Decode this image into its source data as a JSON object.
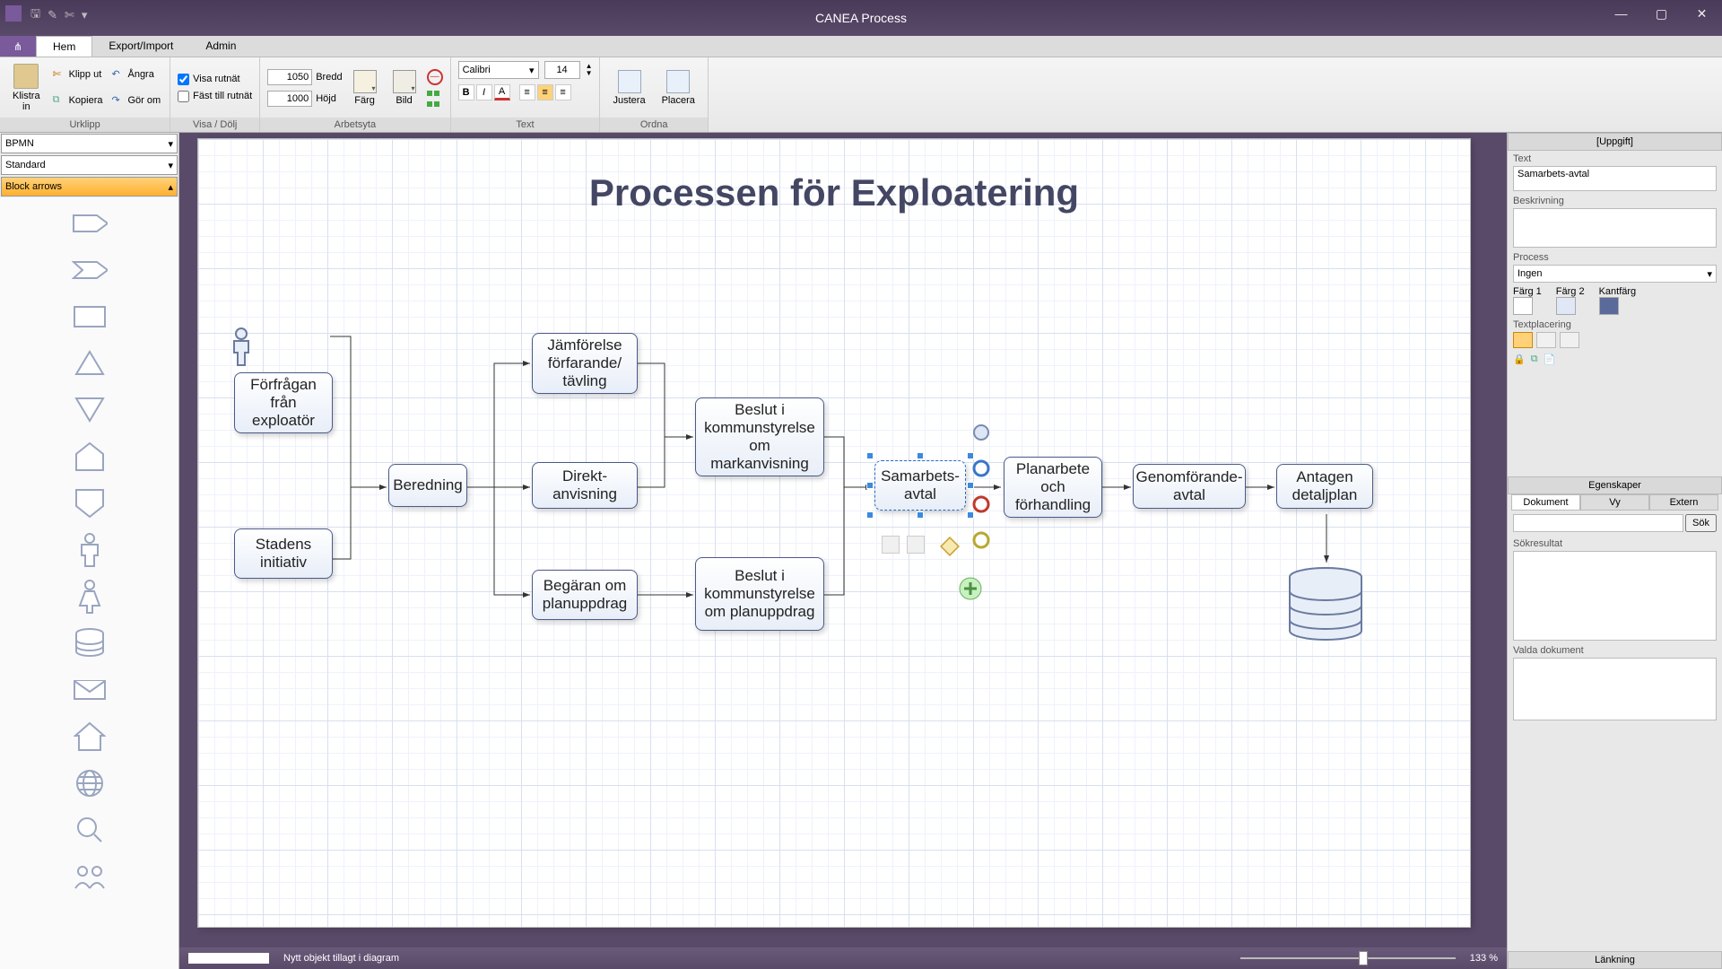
{
  "app": {
    "title": "CANEA Process"
  },
  "tabs": {
    "home": "Hem",
    "export": "Export/Import",
    "admin": "Admin"
  },
  "ribbon": {
    "clipboard": {
      "paste": "Klistra\nin",
      "cut": "Klipp ut",
      "copy": "Kopiera",
      "undo": "Ångra",
      "rename": "Gör om",
      "group": "Urklipp"
    },
    "showhide": {
      "grid": "Visa rutnät",
      "snap": "Fäst till rutnät",
      "group": "Visa / Dölj"
    },
    "workspace": {
      "width_val": "1050",
      "width_lbl": "Bredd",
      "height_val": "1000",
      "height_lbl": "Höjd",
      "color": "Färg",
      "image": "Bild",
      "group": "Arbetsyta"
    },
    "text": {
      "font": "Calibri",
      "size": "14",
      "group": "Text"
    },
    "arrange": {
      "align": "Justera",
      "place": "Placera",
      "group": "Ordna"
    }
  },
  "shape_panel": {
    "cat1": "BPMN",
    "cat2": "Standard",
    "cat3": "Block arrows"
  },
  "diagram": {
    "title": "Processen för Exploatering",
    "n1": "Förfrågan från exploatör",
    "n2": "Stadens initiativ",
    "n3": "Beredning",
    "n4": "Jämförelse förfarande/ tävling",
    "n5": "Direkt-anvisning",
    "n6": "Begäran om planuppdrag",
    "n7": "Beslut i kommunstyrelse om markanvisning",
    "n8": "Beslut i kommunstyrelse om planuppdrag",
    "n9": "Samarbets-avtal",
    "n10": "Planarbete och förhandling",
    "n11": "Genomförande-avtal",
    "n12": "Antagen detaljplan"
  },
  "props": {
    "task": "[Uppgift]",
    "text_lbl": "Text",
    "text_val": "Samarbets-avtal",
    "desc_lbl": "Beskrivning",
    "process_lbl": "Process",
    "process_val": "Ingen",
    "c1": "Färg 1",
    "c2": "Färg 2",
    "c3": "Kantfärg",
    "textplace": "Textplacering",
    "section2": "Egenskaper",
    "tab_doc": "Dokument",
    "tab_view": "Vy",
    "tab_ext": "Extern",
    "sok": "Sök",
    "sokres": "Sökresultat",
    "valda": "Valda dokument",
    "linking": "Länkning"
  },
  "status": {
    "msg": "Nytt objekt tillagt i diagram",
    "zoom": "133 %"
  }
}
